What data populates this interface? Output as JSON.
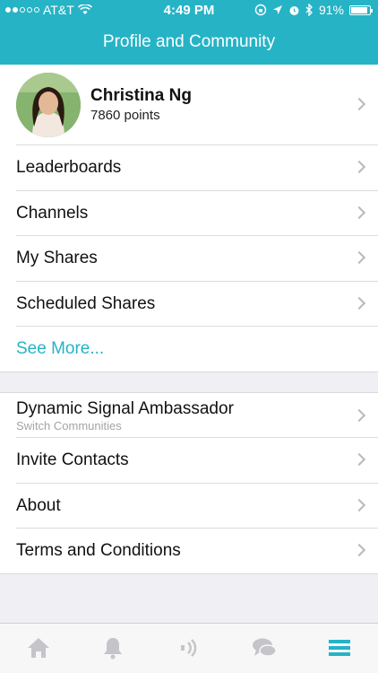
{
  "status": {
    "carrier": "AT&T",
    "time": "4:49 PM",
    "battery": "91%",
    "battery_level": 0.91
  },
  "nav": {
    "title": "Profile and Community"
  },
  "profile": {
    "name": "Christina Ng",
    "points": "7860 points"
  },
  "menu": [
    {
      "label": "Leaderboards"
    },
    {
      "label": "Channels"
    },
    {
      "label": "My Shares"
    },
    {
      "label": "Scheduled Shares"
    }
  ],
  "see_more": "See More...",
  "community": {
    "label": "Dynamic Signal Ambassador",
    "sublabel": "Switch Communities"
  },
  "menu2": [
    {
      "label": "Invite Contacts"
    },
    {
      "label": "About"
    },
    {
      "label": "Terms and Conditions"
    }
  ],
  "tabs": [
    "home-icon",
    "bell-icon",
    "signal-icon",
    "chat-icon",
    "menu-icon"
  ],
  "colors": {
    "accent": "#26b3c6",
    "tab_inactive": "#c5c5c9"
  }
}
